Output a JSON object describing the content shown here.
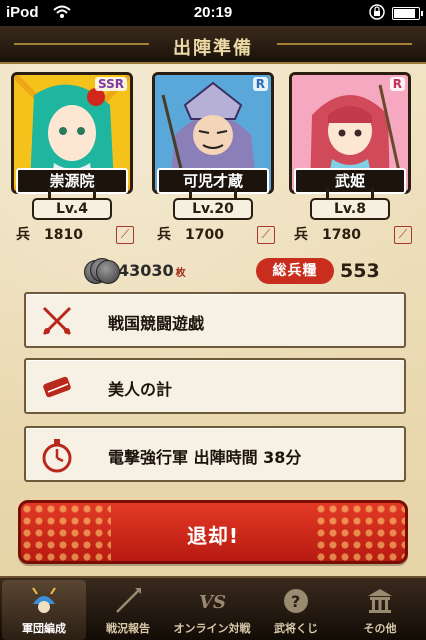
{
  "status_bar": {
    "carrier": "iPod",
    "time": "20:19",
    "battery_level": 0.9
  },
  "header": {
    "title": "出陣準備"
  },
  "generals": [
    {
      "name": "崇源院",
      "level": "Lv.4",
      "troops_symbol": "兵",
      "troops": "1810",
      "rarity": "SSR",
      "colors": {
        "bg": "#f4c21a",
        "accent": "#1fb6a0"
      }
    },
    {
      "name": "可児才蔵",
      "level": "Lv.20",
      "troops_symbol": "兵",
      "troops": "1700",
      "rarity": "R",
      "colors": {
        "bg": "#5aa7d9",
        "accent": "#8a7fb8"
      }
    },
    {
      "name": "武姫",
      "level": "Lv.8",
      "troops_symbol": "兵",
      "troops": "1780",
      "rarity": "R",
      "colors": {
        "bg": "#f5a8c0",
        "accent": "#d14a5a"
      }
    }
  ],
  "resources": {
    "coins": "43030",
    "coin_unit": "枚",
    "total_label": "総兵糧",
    "total_value": "553"
  },
  "orders": [
    {
      "label": "戦国競闘遊戯",
      "icon": "crossed-swords-icon"
    },
    {
      "label": "美人の計",
      "icon": "scroll-icon"
    },
    {
      "label": "電撃強行軍 出陣時間 38分",
      "icon": "stopwatch-icon"
    }
  ],
  "retreat": {
    "label": "退却!"
  },
  "tabs": [
    {
      "label": "軍団編成",
      "icon": "helmet-icon",
      "active": true
    },
    {
      "label": "戦況報告",
      "icon": "spear-icon",
      "active": false
    },
    {
      "label": "オンライン対戦",
      "icon": "versus-icon",
      "active": false
    },
    {
      "label": "武将くじ",
      "icon": "question-icon",
      "active": false
    },
    {
      "label": "その他",
      "icon": "building-icon",
      "active": false
    }
  ],
  "colors": {
    "accent_red": "#c92d1e",
    "paper": "#efe2c2",
    "dark": "#1c140c"
  }
}
